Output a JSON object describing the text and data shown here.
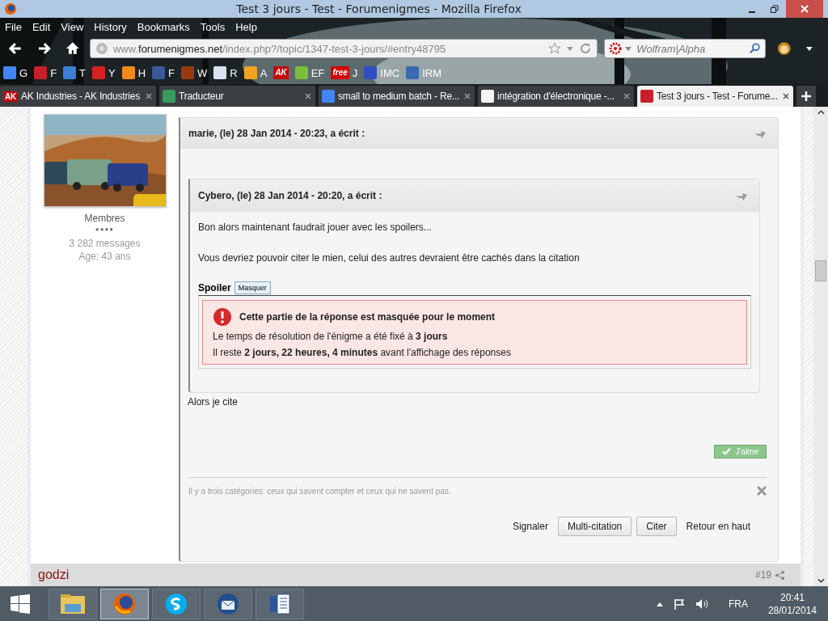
{
  "window": {
    "title": "Test 3 jours - Test - Forumenigmes - Mozilla Firefox"
  },
  "menu": [
    "File",
    "Edit",
    "View",
    "History",
    "Bookmarks",
    "Tools",
    "Help"
  ],
  "address": {
    "prefix": "www.",
    "host": "forumenigmes.net",
    "path": "/index.php?/topic/1347-test-3-jours/#entry48795"
  },
  "search": {
    "placeholder": "Wolfram|Alpha"
  },
  "bookmarks": [
    {
      "label": "G",
      "color": "#4285f4"
    },
    {
      "label": "F",
      "color": "#c8202a"
    },
    {
      "label": "T",
      "color": "#3b7fd6"
    },
    {
      "label": "Y",
      "color": "#d62020"
    },
    {
      "label": "H",
      "color": "#f08a1c"
    },
    {
      "label": "F",
      "color": "#3b5998"
    },
    {
      "label": "W",
      "color": "#9a3a12"
    },
    {
      "label": "R",
      "color": "#d8e4f0"
    },
    {
      "label": "A",
      "color": "#f2a320"
    },
    {
      "badge": "AK",
      "color": "#c40a0a"
    },
    {
      "label": "EF",
      "color": "#7bbf3a"
    },
    {
      "badge": "free",
      "label": "J",
      "color": "#d40000"
    },
    {
      "label": "IMC",
      "color": "#3050c0"
    },
    {
      "label": "IRM",
      "color": "#3a6ab0"
    }
  ],
  "tabs": [
    {
      "title": "AK Industries - AK Industries",
      "badge": "AK",
      "color": "#c40a0a",
      "selected": false
    },
    {
      "title": "Traducteur",
      "color": "#3a9a5b",
      "selected": false
    },
    {
      "title": "small to medium batch - Re...",
      "color": "#4285f4",
      "selected": false
    },
    {
      "title": "intégration d'électronique -...",
      "color": "#f4f4f4",
      "selected": false
    },
    {
      "title": "Test 3 jours - Test - Forume...",
      "color": "#c8202a",
      "selected": true
    }
  ],
  "profile": {
    "group": "Membres",
    "rank_pips": "●●●●",
    "posts": "3 282 messages",
    "age": "Age: 43 ans"
  },
  "post": {
    "quote_header": "marie, (le) 28 Jan 2014 - 20:23, a écrit :",
    "inner_quote": {
      "header": "Cybero, (le) 28 Jan 2014 - 20:20, a écrit :",
      "paragraphs": [
        "Bon alors maintenant faudrait jouer avec les spoilers...",
        "Vous devriez pouvoir citer le mien, celui des autres devraient être cachés dans la citation"
      ],
      "spoiler": {
        "label": "Spoiler",
        "button": "Masquer",
        "alert_title": "Cette partie de la réponse est masquée pour le moment",
        "lines": [
          "Le temps de résolution de l'énigme a été fixé à **3 jours**",
          "Il reste **2 jours, 22 heures, 4 minutes** avant l'affichage des réponses"
        ]
      }
    },
    "reply": "Alors je cite",
    "like_button": "J'aime",
    "signature": "Il y a trois catégories: ceux qui savent compter et ceux qui ne savent pas.",
    "actions": [
      {
        "kind": "link",
        "label": "Signaler"
      },
      {
        "kind": "button",
        "label": "Multi-citation"
      },
      {
        "kind": "button",
        "label": "Citer"
      },
      {
        "kind": "link",
        "label": "Retour en haut"
      }
    ]
  },
  "next_post": {
    "author": "godzi",
    "number": "#19"
  },
  "taskbar": {
    "apps": [
      {
        "kind": "explorer",
        "selected": false
      },
      {
        "kind": "firefox",
        "selected": true
      },
      {
        "kind": "skype",
        "selected": false
      },
      {
        "kind": "thunderbird",
        "selected": false
      },
      {
        "kind": "word",
        "selected": false
      }
    ],
    "language": "FRA",
    "time": "20:41",
    "date": "28/01/2014"
  }
}
